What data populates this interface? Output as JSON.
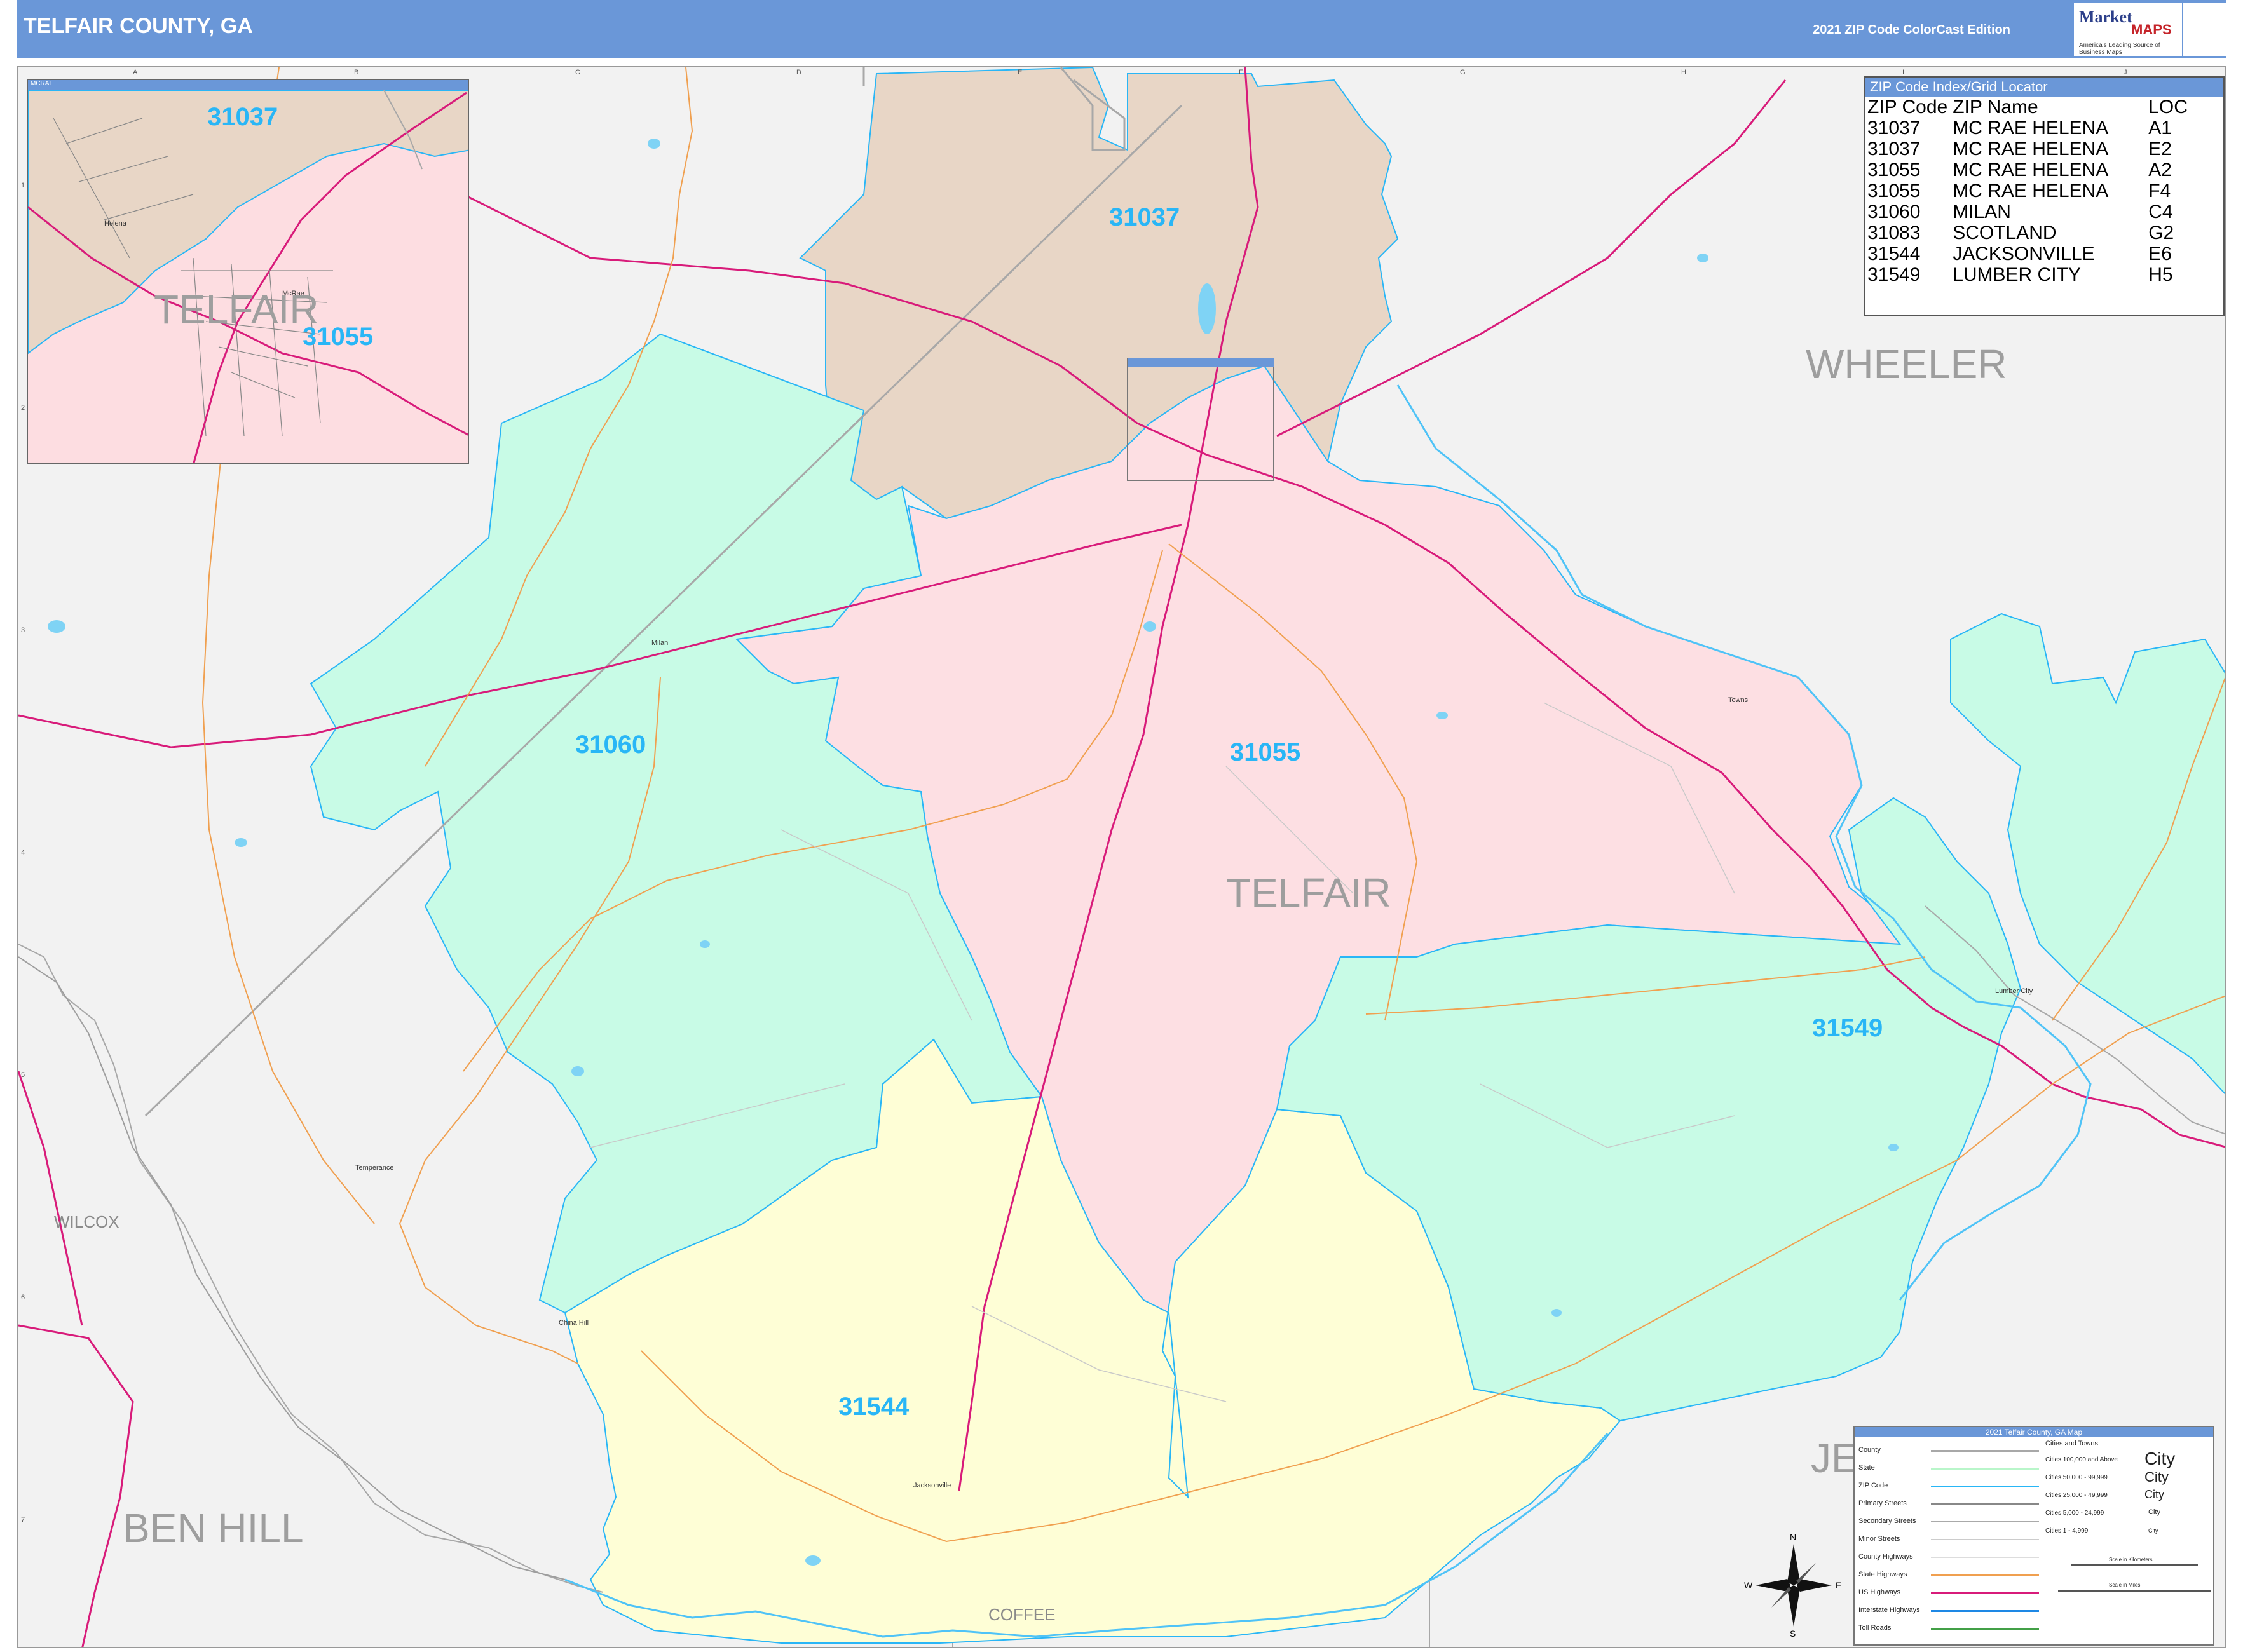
{
  "header": {
    "title": "TELFAIR COUNTY, GA",
    "edition": "2021 ZIP Code ColorCast Edition",
    "brand": "Market",
    "brand_maps": "MAPS",
    "slogan": "America's Leading Source of Business Maps"
  },
  "colors": {
    "zip_31037": "#e8d6c6",
    "zip_31055": "#fddfe3",
    "zip_31060": "#c8fbe6",
    "zip_31544": "#fefed6",
    "zip_31549": "#c8fbe6",
    "outside": "#f2f2f2",
    "zip_label": "#29b6f6",
    "us_highway": "#d81b7a",
    "state_highway": "#f0a050",
    "county_border": "#a8a8a8",
    "zip_border": "#29b6f6"
  },
  "grid": {
    "columns": [
      "A",
      "B",
      "C",
      "D",
      "E",
      "F",
      "G",
      "H",
      "I",
      "J"
    ],
    "rows": [
      "1",
      "2",
      "3",
      "4",
      "5",
      "6",
      "7"
    ]
  },
  "zip_index": {
    "title": "ZIP Code Index/Grid Locator",
    "columns": [
      "ZIP Code",
      "ZIP Name",
      "LOC"
    ],
    "rows": [
      [
        "31037",
        "MC RAE HELENA",
        "A1"
      ],
      [
        "31037",
        "MC RAE HELENA",
        "E2"
      ],
      [
        "31055",
        "MC RAE HELENA",
        "A2"
      ],
      [
        "31055",
        "MC RAE HELENA",
        "F4"
      ],
      [
        "31060",
        "MILAN",
        "C4"
      ],
      [
        "31083",
        "SCOTLAND",
        "G2"
      ],
      [
        "31544",
        "JACKSONVILLE",
        "E6"
      ],
      [
        "31549",
        "LUMBER CITY",
        "H5"
      ]
    ]
  },
  "zip_labels": {
    "z31037": "31037",
    "z31055": "31055",
    "z31060": "31060",
    "z31544": "31544",
    "z31549": "31549"
  },
  "county_labels": {
    "telfair": "TELFAIR",
    "wheeler": "WHEELER",
    "ben_hill": "BEN HILL",
    "wilcox": "WILCOX",
    "coffee": "COFFEE",
    "jeff_davis_partial": "JE"
  },
  "towns": {
    "milan": "Milan",
    "towns": "Towns",
    "temperance": "Temperance",
    "china_hill": "China Hill",
    "jacksonville": "Jacksonville",
    "lumber_city": "Lumber City",
    "mcrae": "McRae",
    "helena": "Helena"
  },
  "inset": {
    "title": "MCRAE",
    "zip_top": "31037",
    "zip_bottom": "31055",
    "county": "TELFAIR"
  },
  "legend": {
    "title": "2021 Telfair County, GA Map",
    "items": [
      "County",
      "State",
      "ZIP Code",
      "Primary Streets",
      "Secondary Streets",
      "Minor Streets",
      "County Highways",
      "State Highways",
      "US Highways",
      "Interstate Highways",
      "Toll Roads"
    ],
    "cities_heading": "Cities and Towns",
    "cities": [
      [
        "Cities 100,000 and Above",
        "City"
      ],
      [
        "Cities 50,000 - 99,999",
        "City"
      ],
      [
        "Cities 25,000 - 49,999",
        "City"
      ],
      [
        "Cities 5,000 - 24,999",
        "City"
      ],
      [
        "Cities 1 - 4,999",
        "City"
      ]
    ],
    "scale_km": "Scale in Kilometers",
    "scale_mi": "Scale in Miles",
    "compass": [
      "N",
      "E",
      "S",
      "W"
    ]
  }
}
